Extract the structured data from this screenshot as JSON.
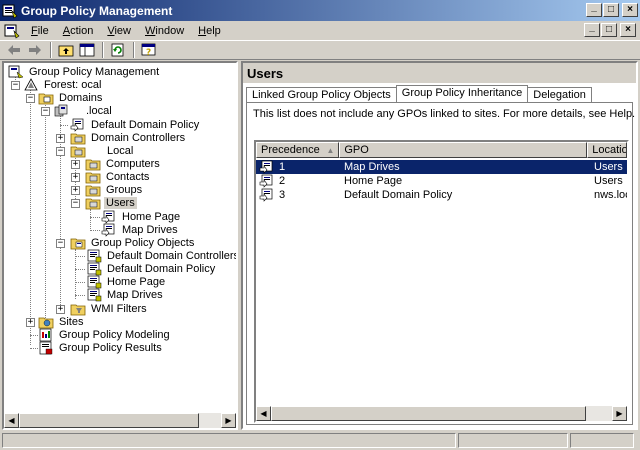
{
  "window": {
    "title": "Group Policy Management",
    "buttons": {
      "minimize": "_",
      "maximize": "□",
      "close": "×"
    }
  },
  "menu": {
    "items": [
      {
        "label": "File",
        "key": "F",
        "rest": "ile"
      },
      {
        "label": "Action",
        "key": "A",
        "rest": "ction"
      },
      {
        "label": "View",
        "key": "V",
        "rest": "iew"
      },
      {
        "label": "Window",
        "key": "W",
        "rest": "indow"
      },
      {
        "label": "Help",
        "key": "H",
        "rest": "elp"
      }
    ]
  },
  "toolbar": {
    "icons": [
      "back-arrow-icon",
      "forward-arrow-icon",
      "up-folder-icon",
      "show-hide-tree-icon",
      "refresh-icon",
      "help-icon"
    ]
  },
  "tree": {
    "root": "Group Policy Management",
    "forest": "Forest:        ocal",
    "domains": "Domains",
    "domain": ".local",
    "default_domain_policy": "Default Domain Policy",
    "domain_controllers": "Domain Controllers",
    "ou": "Local",
    "computers": "Computers",
    "contacts": "Contacts",
    "groups": "Groups",
    "users": "Users",
    "users_home_page": "Home Page",
    "users_map_drives": "Map Drives",
    "gpo_container": "Group Policy Objects",
    "gpo_default_dc": "Default Domain Controllers Policy",
    "gpo_default_domain": "Default Domain Policy",
    "gpo_home_page": "Home Page",
    "gpo_map_drives": "Map Drives",
    "wmi_filters": "WMI Filters",
    "sites": "Sites",
    "modeling": "Group Policy Modeling",
    "results": "Group Policy Results"
  },
  "details": {
    "heading": "Users",
    "tabs": [
      "Linked Group Policy Objects",
      "Group Policy Inheritance",
      "Delegation"
    ],
    "active_tab": "Group Policy Inheritance",
    "note": "This list does not include any GPOs linked to sites. For more details, see Help.",
    "columns": [
      "Precedence",
      "GPO",
      "Location"
    ],
    "sort_indicator": "▲",
    "rows": [
      {
        "precedence": "1",
        "gpo": "Map Drives",
        "location": "Users",
        "selected": true
      },
      {
        "precedence": "2",
        "gpo": "Home Page",
        "location": "Users",
        "selected": false
      },
      {
        "precedence": "3",
        "gpo": "Default Domain Policy",
        "location": "nws.local",
        "selected": false
      }
    ]
  },
  "colors": {
    "title_start": "#0a246a",
    "title_end": "#a6caf0",
    "selection": "#0a246a",
    "face": "#d4d0c8"
  }
}
